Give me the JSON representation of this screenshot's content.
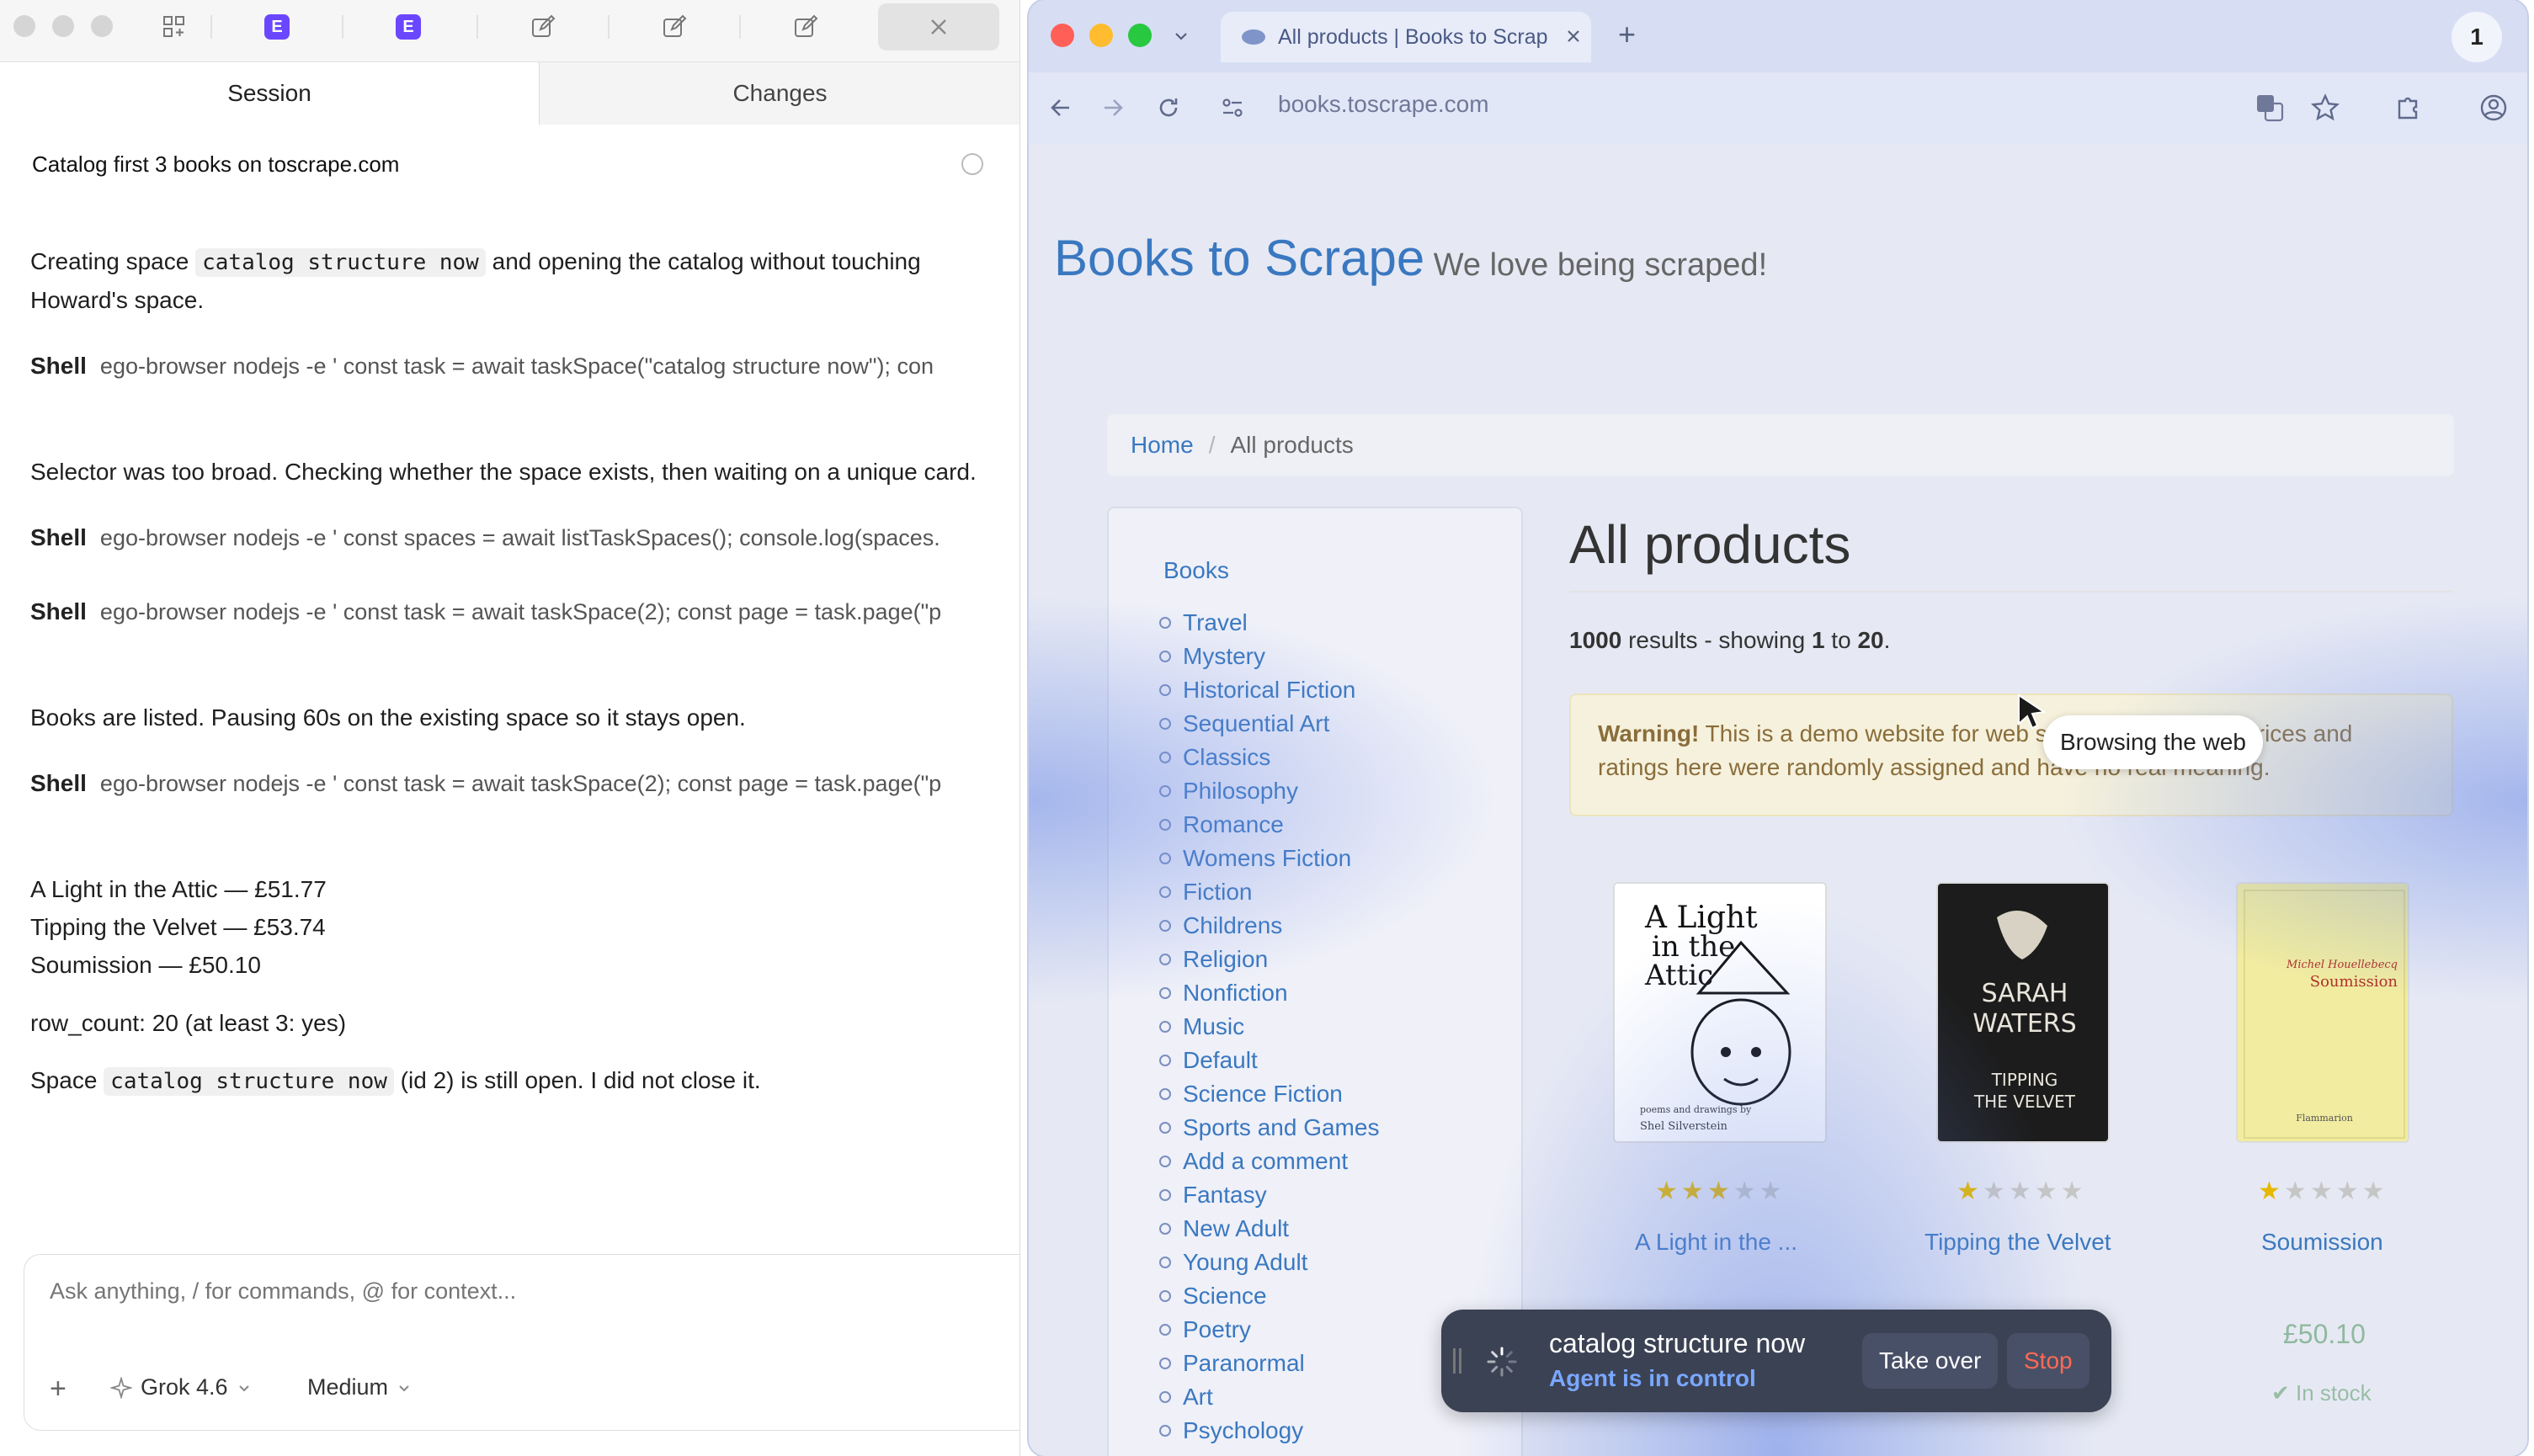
{
  "left_app": {
    "toolbar": {
      "badge_a": "E",
      "badge_b": "E"
    },
    "tabs": {
      "session": "Session",
      "changes": "Changes"
    },
    "session_title": "Catalog first 3 books on toscrape.com",
    "messages": {
      "m1_pre": "Creating space ",
      "m1_code": "catalog structure now",
      "m1_post": " and opening the catalog without touching",
      "m1_line2": "Howard's space.",
      "m2": "Selector was too broad. Checking whether the space exists, then waiting on a unique card.",
      "m3": "Books are listed. Pausing 60s on the existing space so it stays open.",
      "result_1": "A Light in the Attic — £51.77",
      "result_2": "Tipping the Velvet — £53.74",
      "result_3": "Soumission — £50.10",
      "row_count": "row_count: 20 (at least 3: yes)",
      "final_pre": "Space ",
      "final_code": "catalog structure now",
      "final_post": " (id 2) is still open. I did not close it."
    },
    "shells": {
      "label": "Shell",
      "cmd_1": "ego-browser nodejs -e ' const task = await taskSpace(\"catalog structure now\"); con",
      "cmd_2": "ego-browser nodejs -e ' const spaces = await listTaskSpaces(); console.log(spaces.",
      "cmd_3": "ego-browser nodejs -e ' const task = await taskSpace(2); const page = task.page(\"p",
      "cmd_4": "ego-browser nodejs -e ' const task = await taskSpace(2); const page = task.page(\"p"
    },
    "composer": {
      "placeholder": "Ask anything, / for commands, @ for context...",
      "add": "+",
      "model": "Grok 4.6",
      "effort": "Medium"
    }
  },
  "browser": {
    "tab_title": "All products | Books to Scrap",
    "new_tab": "+",
    "profile_number": "1",
    "url": "books.toscrape.com",
    "site": {
      "title": "Books to Scrape",
      "tagline": "We love being scraped!",
      "breadcrumb_home": "Home",
      "breadcrumb_sep": "/",
      "breadcrumb_current": "All products",
      "sidebar_heading": "Books",
      "categories": [
        "Travel",
        "Mystery",
        "Historical Fiction",
        "Sequential Art",
        "Classics",
        "Philosophy",
        "Romance",
        "Womens Fiction",
        "Fiction",
        "Childrens",
        "Religion",
        "Nonfiction",
        "Music",
        "Default",
        "Science Fiction",
        "Sports and Games",
        "Add a comment",
        "Fantasy",
        "New Adult",
        "Young Adult",
        "Science",
        "Poetry",
        "Paranormal",
        "Art",
        "Psychology"
      ],
      "heading": "All products",
      "results": {
        "total": "1000",
        "mid": " results - showing ",
        "from": "1",
        "to_word": " to ",
        "to": "20",
        "end": "."
      },
      "warning_bold": "Warning!",
      "warning_text": " This is a demo website for web scraping purposes. Prices and ratings here were randomly assigned and have no real meaning.",
      "tooltip": "Browsing the web",
      "books": [
        {
          "title": "A Light in the ...",
          "rating": 3,
          "cover_lines": [
            "A Light",
            "in the",
            "Attic"
          ],
          "cover_sub": "poems and drawings by",
          "cover_author": "Shel Silverstein"
        },
        {
          "title": "Tipping the Velvet",
          "rating": 1,
          "cover_lines": [
            "SARAH",
            "WATERS"
          ],
          "cover_sub_lines": [
            "TIPPING",
            "THE VELVET"
          ]
        },
        {
          "title": "Soumission",
          "rating": 1,
          "cover_author": "Michel Houellebecq",
          "cover_title": "Soumission",
          "cover_pub": "Flammarion"
        }
      ],
      "price_3": "£50.10",
      "stock_3": "✔ In stock"
    },
    "agent_bar": {
      "space_name": "catalog structure now",
      "status": "Agent is in control",
      "take_over": "Take over",
      "stop": "Stop"
    }
  },
  "colors": {
    "accent_purple": "#6b46ff",
    "link_blue": "#3a78c0",
    "agent_blue": "#7aa7ff",
    "stop_red": "#ff6a55",
    "star_gold": "#e6b800"
  }
}
